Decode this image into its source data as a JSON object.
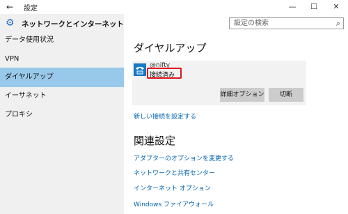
{
  "window": {
    "title": "設定",
    "back_glyph": "←",
    "minimize_glyph": "—",
    "maximize_glyph": "☐",
    "close_glyph": "✕"
  },
  "app": {
    "header_title": "ネットワークとインターネット",
    "header_icon": "gear-icon"
  },
  "search": {
    "placeholder": "設定の検索",
    "icon": "search-icon"
  },
  "sidebar": {
    "items": [
      {
        "label": "データ使用状況",
        "active": false
      },
      {
        "label": "VPN",
        "active": false
      },
      {
        "label": "ダイヤルアップ",
        "active": true
      },
      {
        "label": "イーサネット",
        "active": false
      },
      {
        "label": "プロキシ",
        "active": false
      }
    ]
  },
  "main": {
    "heading": "ダイヤルアップ",
    "connection": {
      "name": "@nifty",
      "status": "接続済み",
      "icon": "dialup-phone-icon"
    },
    "buttons": {
      "advanced": "詳細オプション",
      "disconnect": "切断"
    },
    "new_connection_link": "新しい接続を設定する",
    "related_heading": "関連設定",
    "related_links": [
      "アダプターのオプションを変更する",
      "ネットワークと共有センター",
      "インターネット オプション",
      "Windows ファイアウォール"
    ]
  },
  "colors": {
    "accent": "#0063b1",
    "selected_nav": "#99c9ea",
    "highlight_box": "#e0161d",
    "icon_blue": "#1678c5"
  }
}
